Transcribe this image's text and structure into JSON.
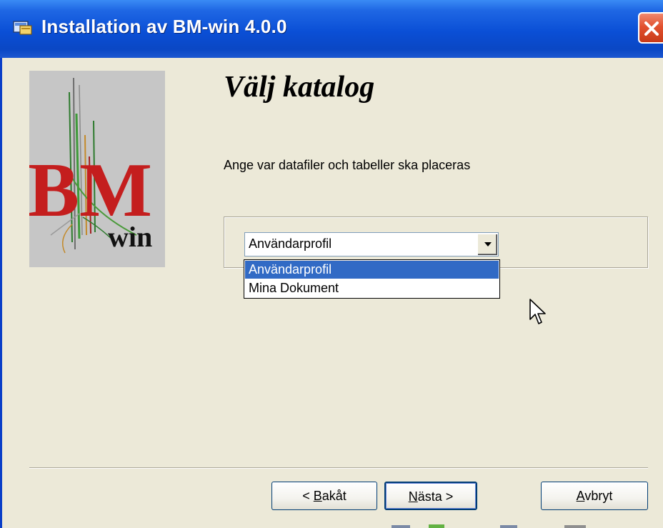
{
  "window": {
    "title": "Installation av BM-win 4.0.0"
  },
  "logo": {
    "letters": "BM",
    "suffix": "win"
  },
  "page": {
    "heading": "Välj katalog",
    "subtitle": "Ange var datafiler och tabeller ska placeras"
  },
  "directory_select": {
    "value": "Användarprofil",
    "options": [
      "Användarprofil",
      "Mina Dokument"
    ]
  },
  "buttons": {
    "back_prefix": "< ",
    "back_key": "B",
    "back_rest": "akåt",
    "next_key": "N",
    "next_rest": "ästa >",
    "cancel_key": "A",
    "cancel_rest": "vbryt"
  },
  "colors": {
    "titlebar": "#0a4fd6",
    "selection": "#316ac5",
    "logo_red": "#c41e1e",
    "dialog_bg": "#ece9d8"
  }
}
